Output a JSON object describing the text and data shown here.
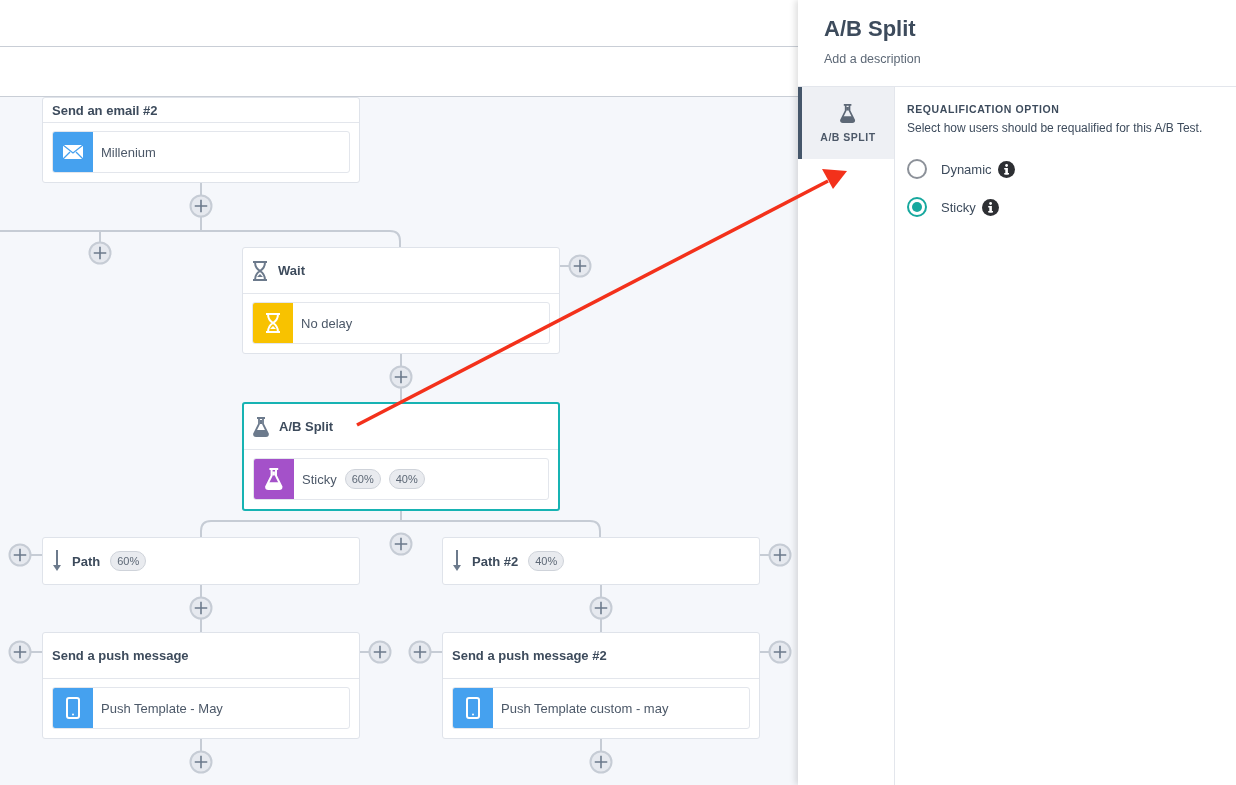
{
  "canvas": {
    "nodes": [
      {
        "kind": "email",
        "title": "Send an email #2",
        "selected": false,
        "item": {
          "text": "Millenium"
        }
      },
      {
        "kind": "wait",
        "title": "Wait",
        "selected": false,
        "item": {
          "text": "No delay"
        }
      },
      {
        "kind": "split",
        "title": "A/B Split",
        "selected": true,
        "item": {
          "text": "Sticky",
          "badges": [
            "60%",
            "40%"
          ]
        }
      },
      {
        "kind": "path",
        "title": "Path",
        "selected": false,
        "badges": [
          "60%"
        ]
      },
      {
        "kind": "path",
        "title": "Path #2",
        "selected": false,
        "badges": [
          "40%"
        ]
      },
      {
        "kind": "push",
        "title": "Send a push message",
        "selected": false,
        "item": {
          "text": "Push Template - May"
        }
      },
      {
        "kind": "push",
        "title": "Send a push message #2",
        "selected": false,
        "item": {
          "text": "Push Template custom - may"
        }
      }
    ]
  },
  "panel": {
    "title": "A/B Split",
    "description": "Add a description",
    "tabs": [
      {
        "label": "A/B SPLIT",
        "selected": true
      }
    ],
    "section": {
      "heading": "REQUALIFICATION OPTION",
      "text": "Select how users should be requalified for this A/B Test.",
      "options": [
        {
          "label": "Dynamic",
          "selected": false
        },
        {
          "label": "Sticky",
          "selected": true
        }
      ]
    }
  }
}
